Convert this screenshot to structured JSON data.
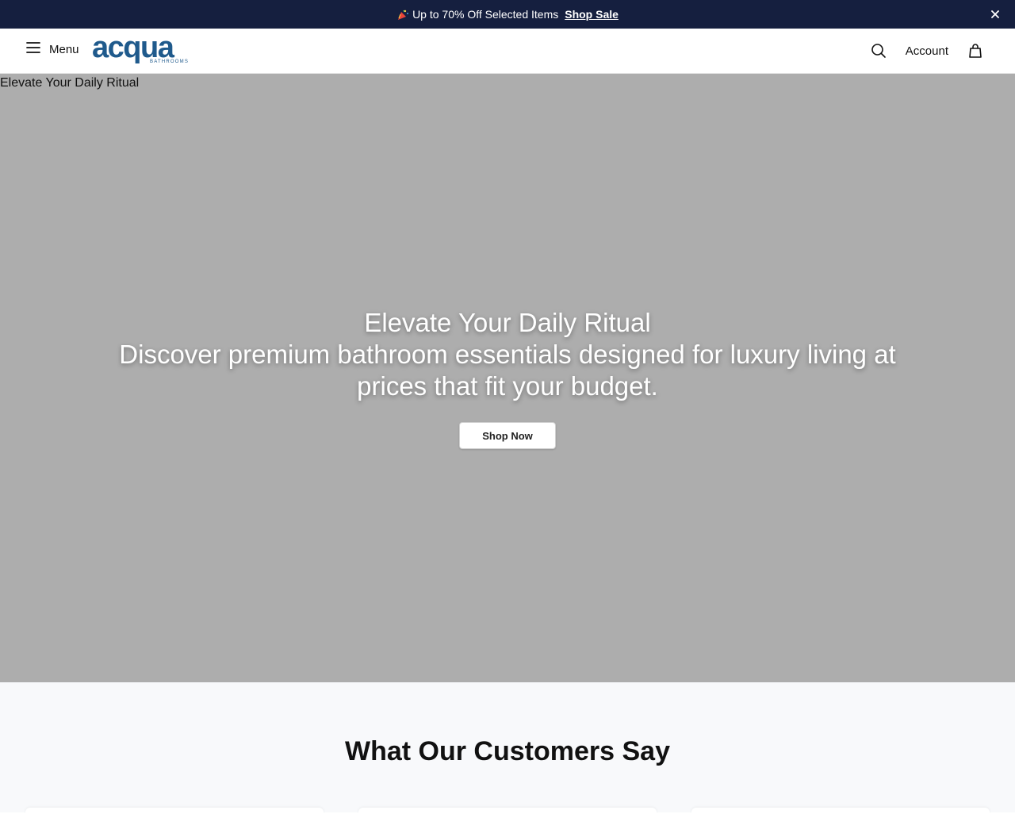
{
  "announcement": {
    "text": "Up to 70% Off Selected Items",
    "link": "Shop Sale"
  },
  "header": {
    "menu_label": "Menu",
    "logo_text": "acqua",
    "logo_subtext": "BATHROOMS",
    "account_label": "Account"
  },
  "hero": {
    "image_alt": "Elevate Your Daily Ritual",
    "title": "Elevate Your Daily Ritual",
    "subtitle": "Discover premium bathroom essentials designed for luxury living at prices that fit your budget.",
    "cta": "Shop Now"
  },
  "testimonials": {
    "heading": "What Our Customers Say"
  },
  "colors": {
    "announcement_bg": "#151f3f",
    "brand": "#1f5a8c",
    "hero_bg": "#adadad"
  },
  "icons": [
    "party-popper-icon",
    "close-icon",
    "hamburger-icon",
    "search-icon",
    "shopping-bag-icon"
  ]
}
